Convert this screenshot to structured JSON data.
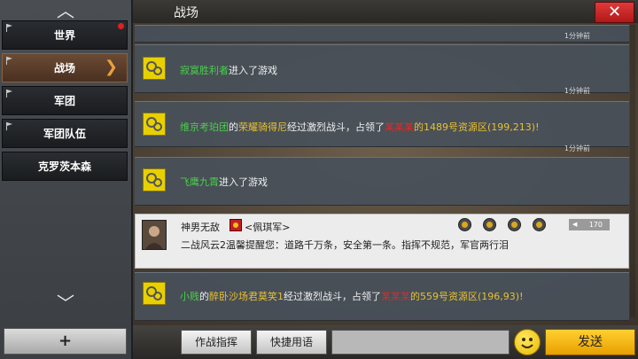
{
  "sidebar": {
    "items": [
      {
        "label": "世界"
      },
      {
        "label": "战场"
      },
      {
        "label": "军团"
      },
      {
        "label": "军团队伍"
      },
      {
        "label": "克罗茨本森"
      }
    ],
    "add_label": "+"
  },
  "header": {
    "title": "战场",
    "close_label": "✕"
  },
  "messages": [
    {
      "time": "1分钟前",
      "parts": [
        "寂寞胜利者",
        "进入了游戏"
      ]
    },
    {
      "time": "1分钟前",
      "parts": [
        "维京考珀团",
        "的",
        "荣耀骑得尼",
        "经过激烈战斗，占领了",
        "某某某",
        "的1489号资源区(199,213)!"
      ]
    },
    {
      "time": "1分钟前",
      "parts": [
        "飞鹰九霄",
        "进入了游戏"
      ]
    },
    {
      "time": "",
      "parts": [
        "小贱",
        "的",
        "醉卧沙场君莫笑1",
        "经过激烈战斗，占领了",
        "某某某",
        "的559号资源区(196,93)!"
      ]
    }
  ],
  "player_message": {
    "name": "神男无敌",
    "clan": "<佩琪军>",
    "text": "二战风云2温馨提醒您：道路千万条，安全第一条。指挥不规范，军官两行泪",
    "rank": "170"
  },
  "bottom": {
    "command_label": "作战指挥",
    "phrases_label": "快捷用语",
    "input_value": "",
    "input_placeholder": "",
    "send_label": "发送"
  },
  "colors": {
    "system_player": "#48d048",
    "highlight_name": "#e8c030",
    "enemy": "#e02828",
    "send_button": "#ffd030",
    "close_button": "#e03a3a"
  }
}
